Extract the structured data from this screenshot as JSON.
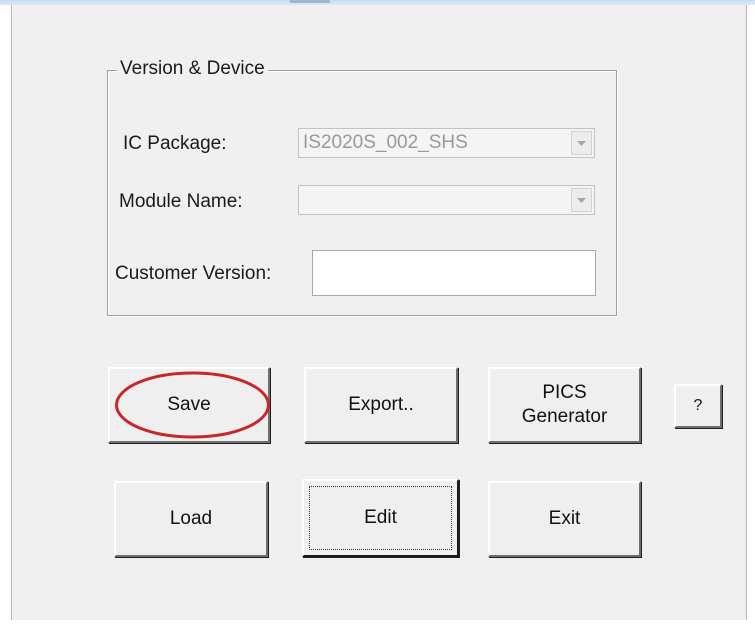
{
  "group_box": {
    "title": "Version & Device"
  },
  "fields": {
    "ic_package": {
      "label": "IC Package:",
      "value": "IS2020S_002_SHS"
    },
    "module_name": {
      "label": "Module Name:",
      "value": ""
    },
    "customer_version": {
      "label": "Customer Version:",
      "value": ""
    }
  },
  "buttons": {
    "save": "Save",
    "export": "Export..",
    "pics_line1": "PICS",
    "pics_line2": "Generator",
    "help": "?",
    "load": "Load",
    "edit": "Edit",
    "exit": "Exit"
  },
  "icons": {
    "dropdown": "chevron-down-icon",
    "highlight": "red-ellipse-annotation"
  },
  "colors": {
    "dialog_background": "#f0f0f0",
    "annotation": "#c8262a",
    "disabled_text": "#9a9a9a"
  }
}
